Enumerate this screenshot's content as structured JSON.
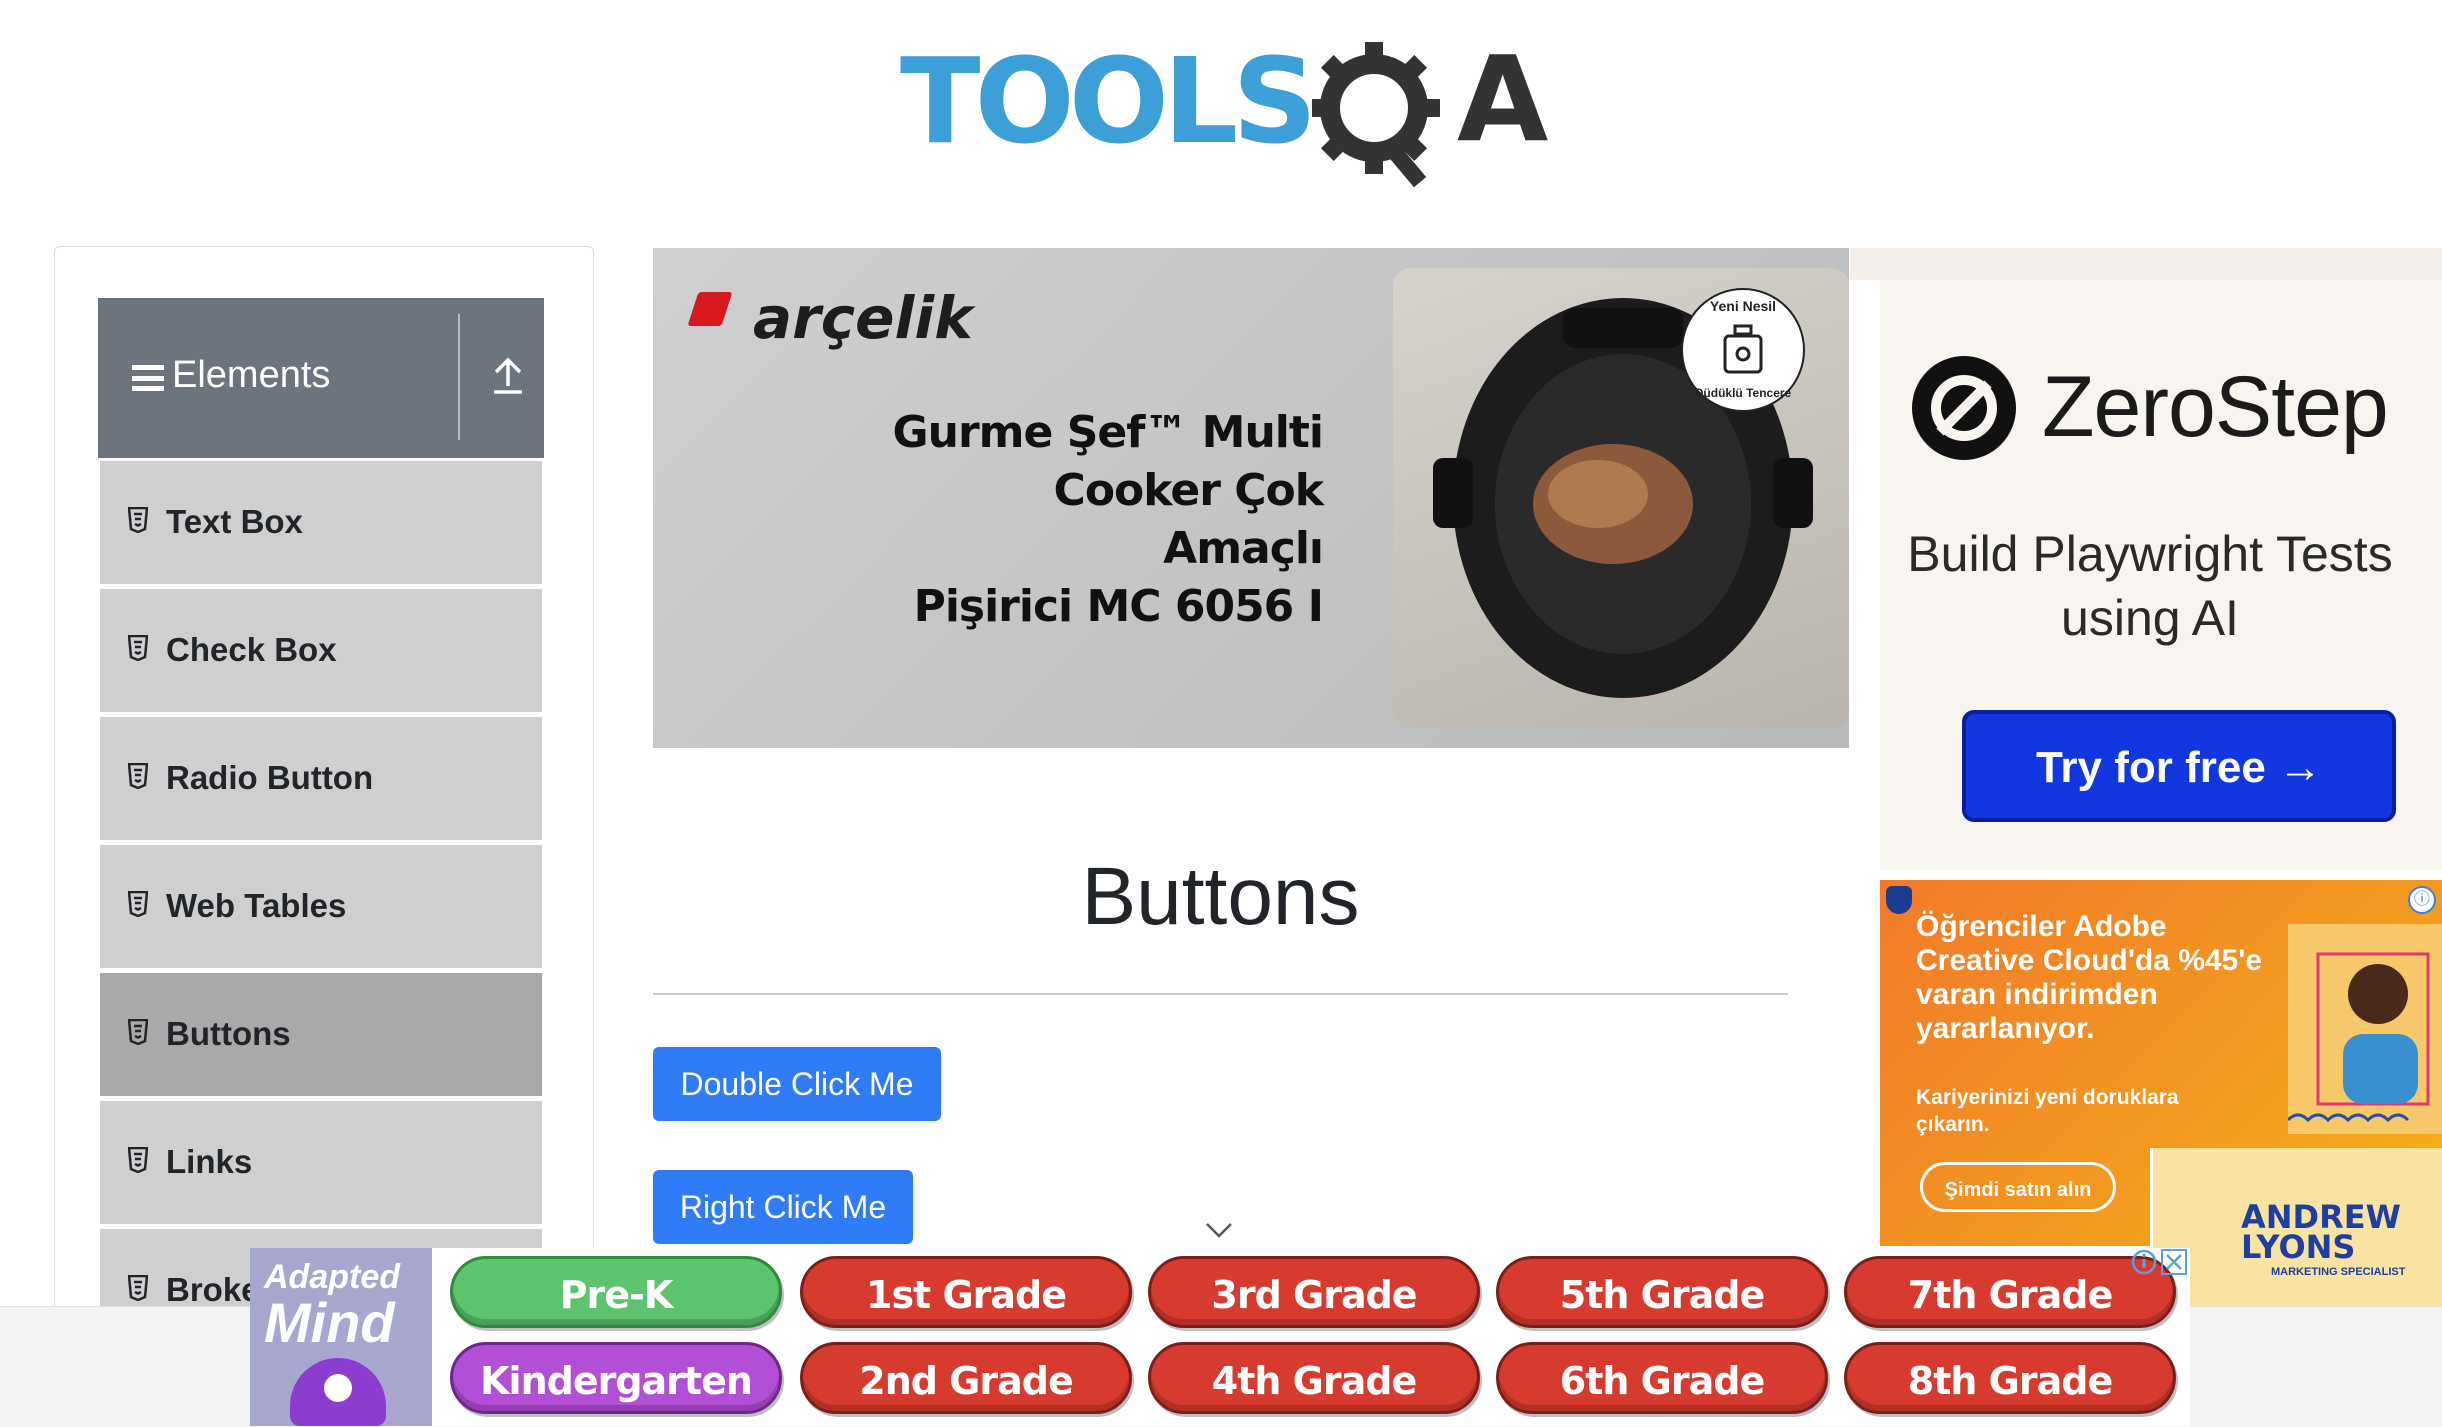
{
  "header": {
    "logo_word": "TOOLS",
    "logo_suffix": "A"
  },
  "sidebar": {
    "group_title": "Elements",
    "items": [
      {
        "label": "Text Box"
      },
      {
        "label": "Check Box"
      },
      {
        "label": "Radio Button"
      },
      {
        "label": "Web Tables"
      },
      {
        "label": "Buttons",
        "active": true
      },
      {
        "label": "Links"
      },
      {
        "label": "Broke"
      }
    ]
  },
  "banner_ad": {
    "brand": "arçelik",
    "headline_lines": [
      "Gurme Şef™ Multi",
      "Cooker Çok Amaçlı",
      "Pişirici MC 6056 I"
    ],
    "stamp_top": "Yeni Nesil",
    "stamp_bottom": "Düdüklü Tencere"
  },
  "main": {
    "title": "Buttons",
    "buttons": {
      "double_click": "Double Click Me",
      "right_click": "Right Click Me"
    }
  },
  "right_ads": {
    "zerostep": {
      "name": "ZeroStep",
      "tagline": "Build Playwright Tests using AI",
      "cta": "Try for free →"
    },
    "adobe": {
      "headline": "Öğrenciler Adobe Creative Cloud'da %45'e varan indirimden yararlanıyor.",
      "sub": "Kariyerinizi yeni doruklara çıkarın.",
      "cta": "Şimdi satın alın",
      "info_glyph": "ⓘ"
    },
    "andrew": {
      "name_line1": "ANDREW",
      "name_line2": "LYONS",
      "role": "MARKETING SPECIALIST"
    }
  },
  "bottom_ad": {
    "logo_line1": "Adapted",
    "logo_line2": "Mind",
    "grades": [
      {
        "label": "Pre-K",
        "color": "#5cc46c"
      },
      {
        "label": "1st Grade",
        "color": "#d73b2f"
      },
      {
        "label": "3rd Grade",
        "color": "#d73b2f"
      },
      {
        "label": "5th Grade",
        "color": "#d73b2f"
      },
      {
        "label": "7th Grade",
        "color": "#d73b2f"
      },
      {
        "label": "Kindergarten",
        "color": "#b24fd6"
      },
      {
        "label": "2nd Grade",
        "color": "#d73b2f"
      },
      {
        "label": "4th Grade",
        "color": "#d73b2f"
      },
      {
        "label": "6th Grade",
        "color": "#d73b2f"
      },
      {
        "label": "8th Grade",
        "color": "#d73b2f"
      }
    ]
  },
  "colors": {
    "accent": "#2f7cf6",
    "sidebar_header": "#6c757d",
    "logo_blue": "#3d9fd8"
  }
}
